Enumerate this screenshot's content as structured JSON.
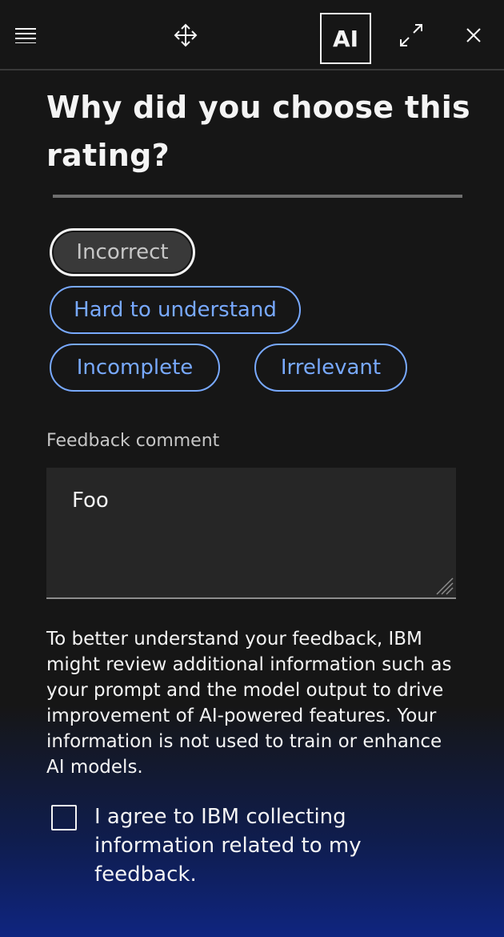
{
  "header": {
    "menu_icon": "menu-icon",
    "move_icon": "move-icon",
    "ai_badge": "AI",
    "expand_icon": "expand-icon",
    "close_icon": "close-icon"
  },
  "feedback": {
    "title": "Why did you choose this rating?",
    "chips": [
      {
        "label": "Incorrect",
        "selected": true
      },
      {
        "label": "Hard to understand",
        "selected": false
      },
      {
        "label": "Incomplete",
        "selected": false
      },
      {
        "label": "Irrelevant",
        "selected": false
      }
    ],
    "comment_label": "Feedback comment",
    "comment_value": "Foo",
    "disclaimer": "To better understand your feedback, IBM might review additional information such as your prompt and the model output to drive improvement of AI-powered features. Your information is not used to train or enhance AI models.",
    "consent_label": "I agree to IBM collecting information related to my feedback.",
    "consent_checked": false
  },
  "colors": {
    "background": "#161616",
    "accent": "#78a9ff",
    "gradient_bottom": "#0f2580"
  }
}
